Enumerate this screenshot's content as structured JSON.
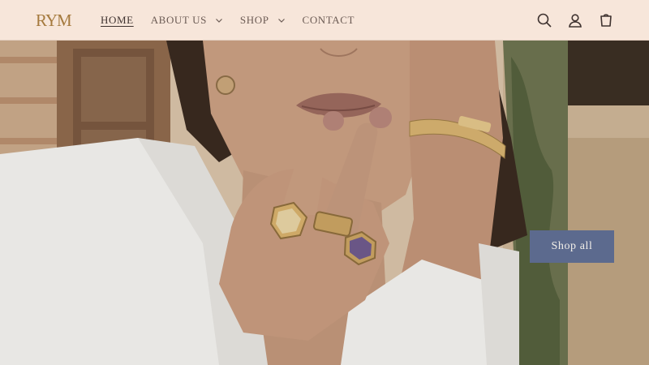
{
  "brand": {
    "logo_text": "RYM"
  },
  "nav": {
    "items": [
      {
        "label": "HOME",
        "active": true,
        "has_dropdown": false
      },
      {
        "label": "ABOUT US",
        "active": false,
        "has_dropdown": true
      },
      {
        "label": "SHOP",
        "active": false,
        "has_dropdown": true
      },
      {
        "label": "CONTACT",
        "active": false,
        "has_dropdown": false
      }
    ]
  },
  "header_icons": [
    "search-icon",
    "account-icon",
    "cart-icon"
  ],
  "hero": {
    "cta_label": "Shop all"
  },
  "colors": {
    "header_bg": "#f7e6da",
    "brand": "#a57a3e",
    "cta_bg": "#5c6a8e"
  }
}
